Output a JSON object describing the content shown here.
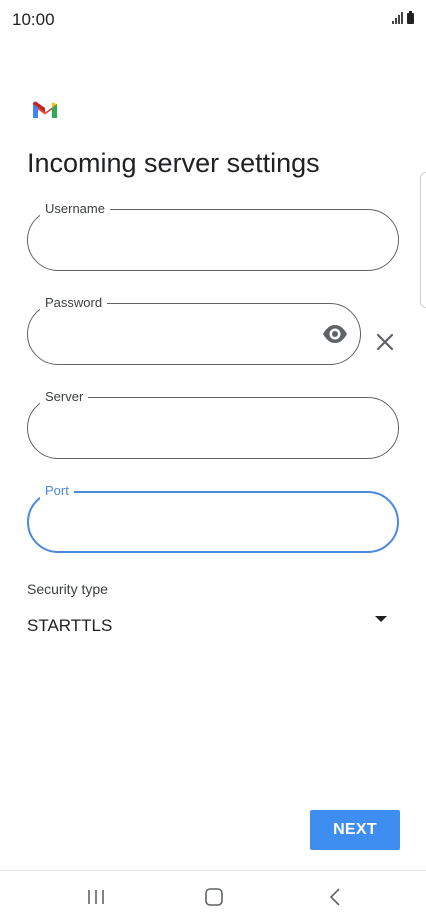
{
  "status_bar": {
    "time": "10:00"
  },
  "page": {
    "title": "Incoming server settings"
  },
  "fields": {
    "username": {
      "label": "Username",
      "value": ""
    },
    "password": {
      "label": "Password",
      "value": ""
    },
    "server": {
      "label": "Server",
      "value": ""
    },
    "port": {
      "label": "Port",
      "value": ""
    }
  },
  "security": {
    "label": "Security type",
    "value": "STARTTLS"
  },
  "actions": {
    "next_label": "NEXT"
  },
  "colors": {
    "accent": "#3d8ef0",
    "focus_outline": "#4a89dc",
    "field_outline": "#5f6368"
  },
  "icons": {
    "logo": "gmail-logo",
    "password_toggle": "eye-icon",
    "clear": "close-icon",
    "dropdown": "caret-down-icon",
    "nav": [
      "recent-apps-icon",
      "home-icon",
      "back-icon"
    ]
  }
}
